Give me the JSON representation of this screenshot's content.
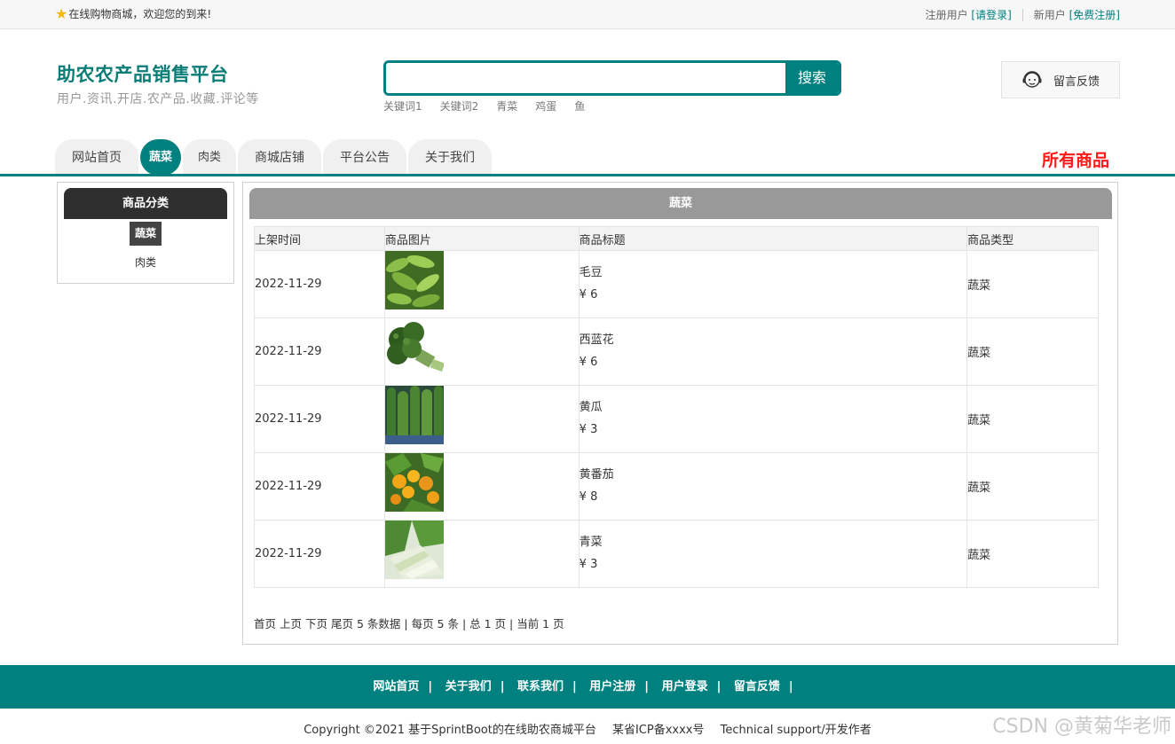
{
  "topbar": {
    "welcome": "在线购物商城，欢迎您的到来!",
    "registered_label": "注册用户",
    "login_link": "[请登录]",
    "new_user_label": "新用户",
    "register_link": "[免费注册]"
  },
  "brand": {
    "title": "助农农产品销售平台",
    "subtitle": "用户.资讯.开店.农产品.收藏.评论等"
  },
  "search": {
    "button": "搜索",
    "value": "",
    "keywords": [
      "关键词1",
      "关键词2",
      "青菜",
      "鸡蛋",
      "鱼"
    ]
  },
  "feedback": {
    "label": "留言反馈",
    "icon": "customer-service-icon"
  },
  "nav": {
    "tabs": [
      "网站首页",
      "蔬菜",
      "肉类",
      "商城店铺",
      "平台公告",
      "关于我们"
    ],
    "active": "蔬菜",
    "all_goods": "所有商品"
  },
  "sidebar": {
    "title": "商品分类",
    "categories": [
      "蔬菜",
      "肉类"
    ]
  },
  "main": {
    "title": "蔬菜",
    "columns": [
      "上架时间",
      "商品图片",
      "商品标题",
      "商品类型"
    ],
    "rows": [
      {
        "date": "2022-11-29",
        "image": "edamame",
        "title": "毛豆",
        "price": "¥ 6",
        "type": "蔬菜"
      },
      {
        "date": "2022-11-29",
        "image": "broccoli",
        "title": "西蓝花",
        "price": "¥ 6",
        "type": "蔬菜"
      },
      {
        "date": "2022-11-29",
        "image": "cucumber",
        "title": "黄瓜",
        "price": "¥ 3",
        "type": "蔬菜"
      },
      {
        "date": "2022-11-29",
        "image": "tomato",
        "title": "黄番茄",
        "price": "¥ 8",
        "type": "蔬菜"
      },
      {
        "date": "2022-11-29",
        "image": "bok-choy",
        "title": "青菜",
        "price": "¥ 3",
        "type": "蔬菜"
      }
    ],
    "pager": {
      "first": "首页",
      "prev": "上页",
      "next": "下页",
      "last": "尾页",
      "info": "5 条数据 | 每页 5 条 | 总 1 页 | 当前 1 页"
    }
  },
  "footer": {
    "links": [
      "网站首页",
      "关于我们",
      "联系我们",
      "用户注册",
      "用户登录",
      "留言反馈"
    ],
    "copyright": "Copyright ©2021 基于SprintBoot的在线助农商城平台",
    "icp": "某省ICP备xxxx号",
    "support": "Technical support/开发作者"
  },
  "watermark": "CSDN @黄菊华老师",
  "colors": {
    "accent": "#00807f",
    "highlight": "#ff1a1a"
  }
}
